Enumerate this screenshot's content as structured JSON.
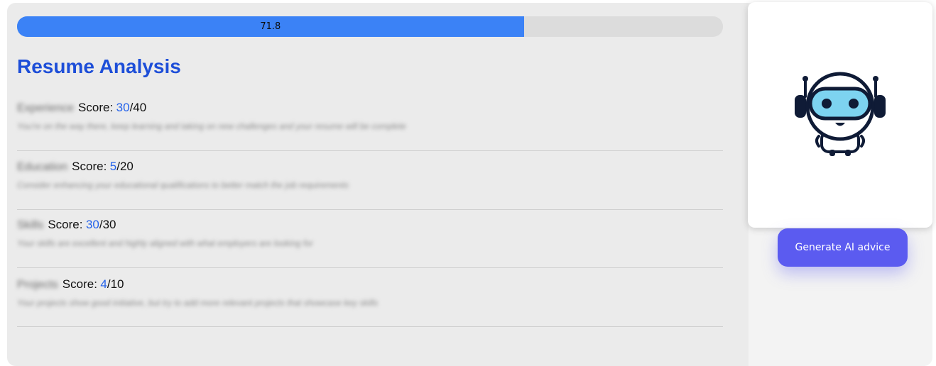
{
  "progress": {
    "value": 71.8,
    "label": "71.8"
  },
  "title": "Resume Analysis",
  "sections": [
    {
      "name": "Experience",
      "score_label": "Score:",
      "score": "30",
      "max": "40",
      "description": "You're on the way there, keep learning and taking on new challenges and your resume will be complete"
    },
    {
      "name": "Education",
      "score_label": "Score:",
      "score": "5",
      "max": "20",
      "description": "Consider enhancing your educational qualifications to better match the job requirements"
    },
    {
      "name": "Skills",
      "score_label": "Score:",
      "score": "30",
      "max": "30",
      "description": "Your skills are excellent and highly aligned with what employers are looking for"
    },
    {
      "name": "Projects",
      "score_label": "Score:",
      "score": "4",
      "max": "10",
      "description": "Your projects show good initiative, but try to add more relevant projects that showcase key skills"
    }
  ],
  "ai_button_label": "Generate AI advice",
  "icons": {
    "robot": "robot-icon"
  },
  "colors": {
    "accent": "#3b82f6",
    "title": "#1d4ed8",
    "score": "#2563eb",
    "button": "#5b5bf0"
  }
}
